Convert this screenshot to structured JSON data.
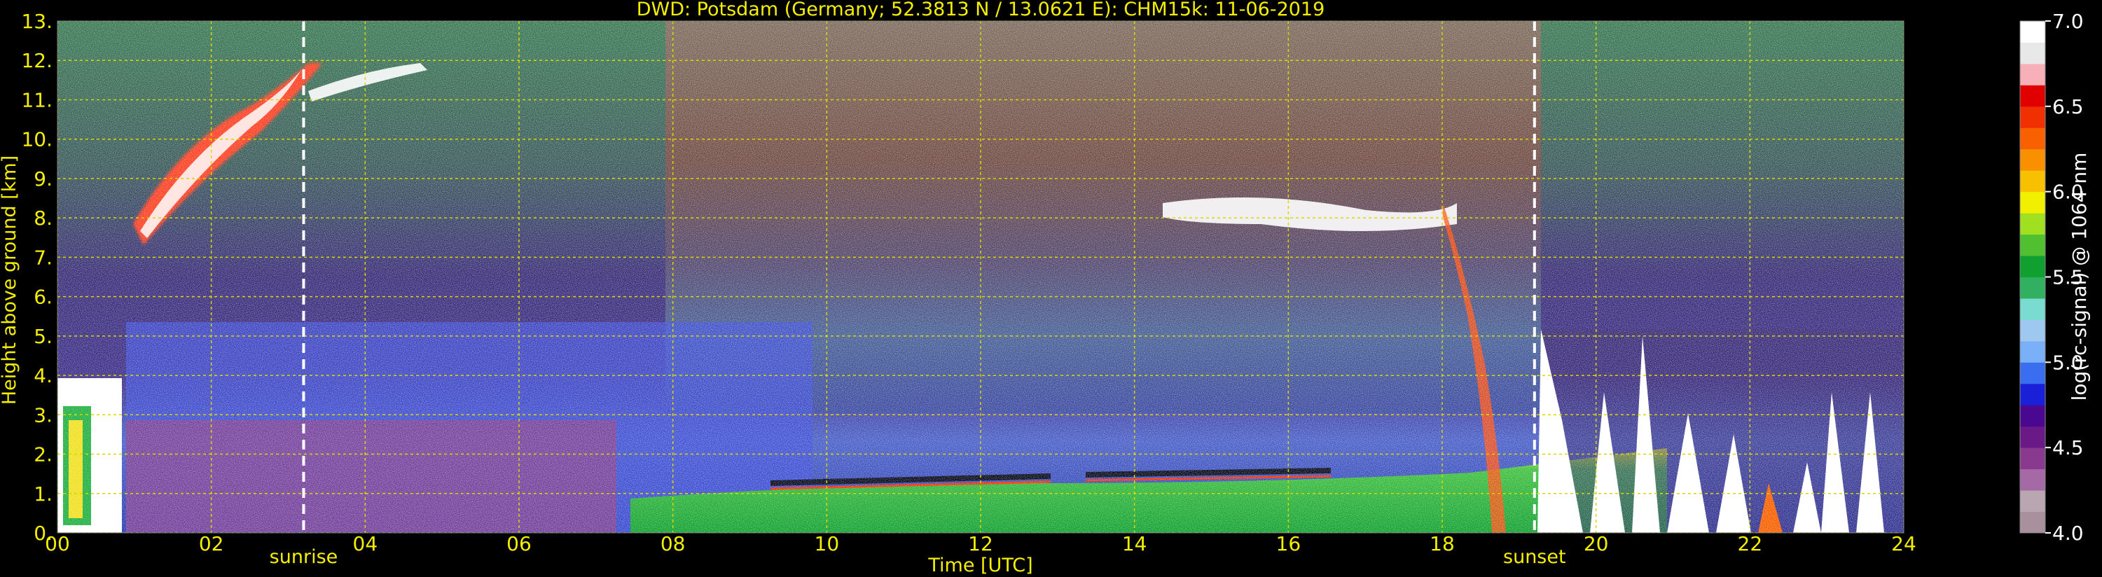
{
  "chart_data": {
    "type": "heatmap",
    "title": "DWD: Potsdam (Germany; 52.3813 N / 13.0621 E):    CHM15k: 11-06-2019",
    "xlabel": "Time [UTC]",
    "ylabel": "Height above ground [km]",
    "xlim": [
      0,
      24
    ],
    "ylim": [
      0,
      13
    ],
    "x_ticks": [
      "00",
      "02",
      "04",
      "06",
      "08",
      "10",
      "12",
      "14",
      "16",
      "18",
      "20",
      "22",
      "24"
    ],
    "x_tick_values": [
      0,
      2,
      4,
      6,
      8,
      10,
      12,
      14,
      16,
      18,
      20,
      22,
      24
    ],
    "y_ticks": [
      "0.",
      "1.",
      "2.",
      "3.",
      "4.",
      "5.",
      "6.",
      "7.",
      "8.",
      "9.",
      "10.",
      "11.",
      "12.",
      "13."
    ],
    "y_tick_values": [
      0,
      1,
      2,
      3,
      4,
      5,
      6,
      7,
      8,
      9,
      10,
      11,
      12,
      13
    ],
    "grid": true,
    "annotations": [
      {
        "label": "sunrise",
        "x": 3.2
      },
      {
        "label": "sunset",
        "x": 19.2
      }
    ],
    "colorbar": {
      "label": "log(rc-signal) @ 1064 nm",
      "range": [
        4.0,
        7.0
      ],
      "tick_labels": [
        "4.0",
        "4.5",
        "5.0",
        "5.5",
        "6.0",
        "6.5",
        "7.0"
      ],
      "tick_values": [
        4.0,
        4.5,
        5.0,
        5.5,
        6.0,
        6.5,
        7.0
      ],
      "colors": [
        "#a8909c",
        "#b8a6b0",
        "#a56aa5",
        "#8a3a8e",
        "#6a1a86",
        "#4a0890",
        "#1a20d8",
        "#3a6ef0",
        "#7ab0f8",
        "#9ec8f0",
        "#7adcd0",
        "#30b060",
        "#10a030",
        "#50c030",
        "#a0e020",
        "#f0f000",
        "#f8c000",
        "#f89000",
        "#f86000",
        "#f03000",
        "#e00000",
        "#f8b0b8",
        "#e8e8e8",
        "#ffffff"
      ]
    }
  },
  "colors": {
    "text": "#f4ee00",
    "grid": "#d8d800",
    "background": "#000000",
    "marker": "#ffffff"
  }
}
